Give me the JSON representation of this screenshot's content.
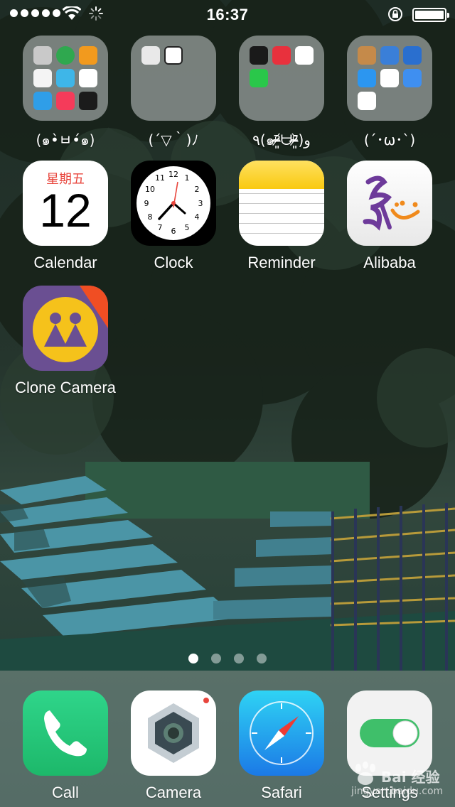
{
  "status_bar": {
    "time": "16:37",
    "signal_dots": 5,
    "wifi_icon": "wifi-icon",
    "activity_icon": "loading-spinner-icon",
    "orientation_lock_icon": "orientation-lock-icon",
    "battery_level": 1.0
  },
  "home": {
    "folders": [
      {
        "name": "(๑•̀ㅂ•́๑)"
      },
      {
        "name": "(´▽｀)ﾉ"
      },
      {
        "name": "٩(๑ᵒ̴̶̷͈᷄ᗨᵒ̴̶̷͈᷅)و"
      },
      {
        "name": "(´･ω･`)"
      }
    ],
    "apps": [
      {
        "label": "Calendar",
        "weekday": "星期五",
        "date": "12"
      },
      {
        "label": "Clock",
        "dial": [
          "12",
          "1",
          "2",
          "3",
          "4",
          "5",
          "6",
          "7",
          "8",
          "9",
          "10",
          "11"
        ]
      },
      {
        "label": "Reminder"
      },
      {
        "label": "Alibaba"
      },
      {
        "label": "Clone Camera"
      }
    ]
  },
  "page_indicator": {
    "pages": 4,
    "current": 1
  },
  "dock": {
    "apps": [
      {
        "label": "Call"
      },
      {
        "label": "Camera"
      },
      {
        "label": "Safari"
      },
      {
        "label": "Settings"
      }
    ]
  },
  "watermark": {
    "text": "Bai 经验",
    "sub": "jingyan.baidu.com"
  },
  "colors": {
    "phone_green": "#27c97a",
    "settings_toggle": "#3fbf6a",
    "calendar_red": "#e8453c",
    "clone_camera_purple": "#6a4f92",
    "clone_camera_yellow": "#f5c21b"
  }
}
